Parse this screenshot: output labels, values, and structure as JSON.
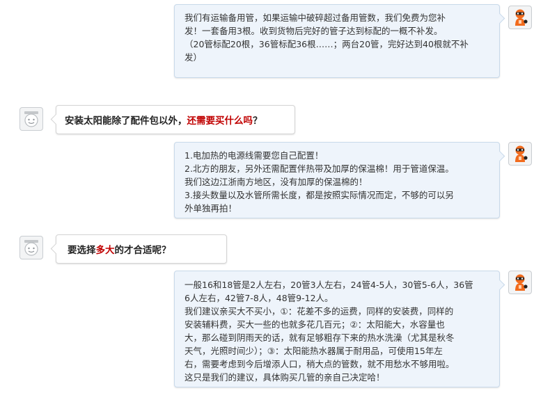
{
  "conversation": {
    "m1": {
      "role": "seller",
      "lines": [
        "我们有运输备用管，如果运输中破碎超过备用管数，我们免费为您补",
        "发！一套备用3根。收到货物后完好的管子达到标配的一概不补发。",
        "（20管标配20根，36管标配36根……；两台20管，完好达到40根就不补",
        "发）"
      ]
    },
    "m2": {
      "role": "buyer",
      "before": "安装太阳能除了配件包以外，",
      "highlight": "还需要买什么吗",
      "after": "？"
    },
    "m3": {
      "role": "seller",
      "lines": [
        "1.电加热的电源线需要您自己配置！",
        "2.北方的朋友，另外还需配置伴热带及加厚的保温棉！用于管道保温。",
        "我们这边江浙南方地区，没有加厚的保温棉的！",
        "3.接头数量以及水管所需长度，都是按照实际情况而定，不够的可以另",
        "外单独再拍！"
      ]
    },
    "m4": {
      "role": "buyer",
      "before": "要选择",
      "highlight": "多大",
      "after": "的才合适呢？"
    },
    "m5": {
      "role": "seller",
      "lines": [
        "一般16和18管是2人左右，20管3人左右，24管4-5人，30管5-6人，36管",
        "6人左右，42管7-8人，48管9-12人。",
        "我们建议亲买大不买小，①：花差不多的运费，同样的安装费，同样的",
        "安装辅料费，买大一些的也就多花几百元；②：太阳能大，水容量也",
        "大，那么碰到阴雨天的话，就有足够粗存下来的热水洗澡（尤其是秋冬",
        "天气，光照时间少）；③：太阳能热水器属于耐用品，可使用15年左",
        "右，需要考虑到今后增添人口，稍大点的管数，就不用愁水不够用啦。",
        "这只是我们的建议，具体购买几管的亲自己决定哈！"
      ]
    }
  },
  "avatars": {
    "seller_icon": "orange-mascot-icon",
    "buyer_icon": "gray-face-icon"
  },
  "colors": {
    "highlight": "#c00000",
    "seller_bubble_bg": "#eef4fb",
    "seller_bubble_border": "#c8d9ea",
    "mascot_orange": "#f26b1d"
  }
}
